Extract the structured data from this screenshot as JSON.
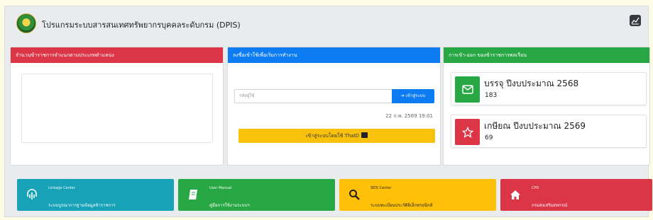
{
  "header": {
    "app_title": "โปรแกรมระบบสารสนเทศทรัพยากรบุคคลระดับกรม (DPIS)",
    "chart_icon": "chart-icon"
  },
  "cards": {
    "officer_count": {
      "title": "จำนวนข้าราชการจำแนกตามประเภทตำแหน่ง"
    },
    "login": {
      "title": "ลงชื่อเข้าใช้เพื่อเริ่มการทำงาน",
      "username_placeholder": "รหัสผู้ใช้",
      "login_button": "เข้าสู่ระบบ",
      "timestamp": "22 ก.พ. 2569 19:01",
      "thaid_button": "เข้าสู่ระบบโดยใช้ ThaID"
    },
    "movement": {
      "title": "การเข้า-ออก ของข้าราชการพลเรือน",
      "items": [
        {
          "title": "บรรจุ ปีงบประมาณ 2568",
          "count": "183",
          "icon": "envelope-icon",
          "color": "#28a745"
        },
        {
          "title": "เกษียณ ปีงบประมาณ 2569",
          "count": "69",
          "icon": "star-icon",
          "color": "#dc3545"
        }
      ]
    }
  },
  "tiles": [
    {
      "label": "Linkage Center",
      "title": "ระบบบูรณาการฐานข้อมูลข้าราชการ",
      "icon": "fingerprint-icon",
      "color": "#17a2b8"
    },
    {
      "label": "User Manual",
      "title": "คู่มือการใช้งานระบบฯ",
      "icon": "book-icon",
      "color": "#28a745"
    },
    {
      "label": "SEIS Center",
      "title": "ระบบทะเบียนประวัติอิเล็กทรอนิกส์",
      "icon": "search-icon",
      "color": "#ffc107"
    },
    {
      "label": "CPD",
      "title": "กรมส่งเสริมสหกรณ์",
      "icon": "home-icon",
      "color": "#dc3545"
    }
  ]
}
